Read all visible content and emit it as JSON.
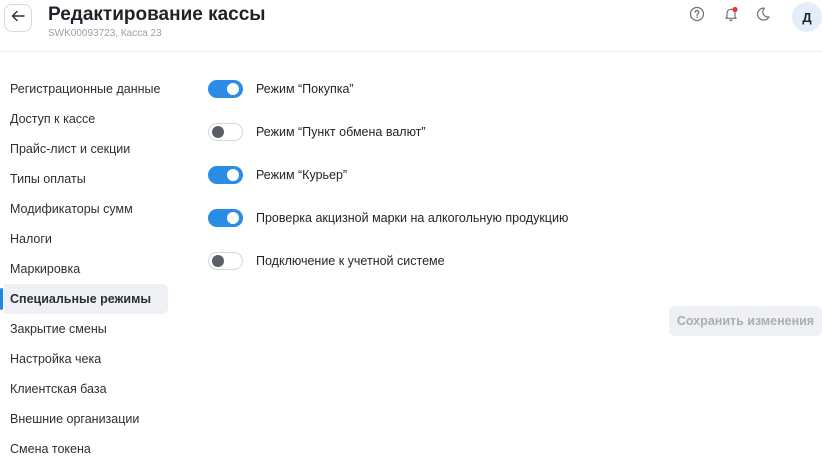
{
  "header": {
    "title": "Редактирование кассы",
    "subtitle": "SWK00093723, Касса 23",
    "avatar_letter": "Д"
  },
  "sidebar": {
    "items": [
      {
        "label": "Регистрационные данные",
        "active": false
      },
      {
        "label": "Доступ к кассе",
        "active": false
      },
      {
        "label": "Прайс-лист и секции",
        "active": false
      },
      {
        "label": "Типы оплаты",
        "active": false
      },
      {
        "label": "Модификаторы сумм",
        "active": false
      },
      {
        "label": "Налоги",
        "active": false
      },
      {
        "label": "Маркировка",
        "active": false
      },
      {
        "label": "Специальные режимы",
        "active": true
      },
      {
        "label": "Закрытие смены",
        "active": false
      },
      {
        "label": "Настройка чека",
        "active": false
      },
      {
        "label": "Клиентская база",
        "active": false
      },
      {
        "label": "Внешние организации",
        "active": false
      },
      {
        "label": "Смена токена",
        "active": false
      }
    ]
  },
  "settings": [
    {
      "label": "Режим “Покупка”",
      "enabled": true
    },
    {
      "label": "Режим “Пункт обмена валют”",
      "enabled": false
    },
    {
      "label": "Режим “Курьер”",
      "enabled": true
    },
    {
      "label": "Проверка акцизной марки на алкогольную продукцию",
      "enabled": true
    },
    {
      "label": "Подключение к учетной системе",
      "enabled": false
    }
  ],
  "actions": {
    "save_label": "Сохранить изменения",
    "save_disabled": true
  },
  "colors": {
    "accent": "#2b8ce6",
    "notification_dot": "#e53935",
    "active_indicator": "#1e88e5"
  },
  "icons": [
    "back-arrow-icon",
    "help-icon",
    "bell-icon",
    "moon-icon"
  ]
}
